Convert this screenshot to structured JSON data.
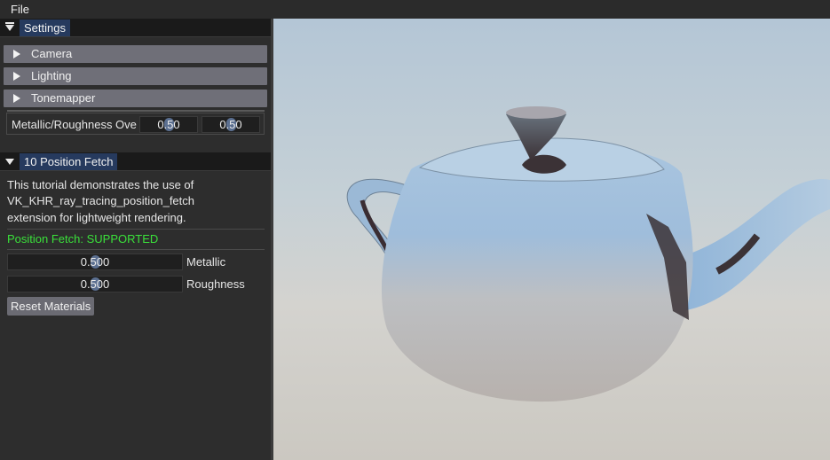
{
  "menubar": {
    "file": "File"
  },
  "settings": {
    "title": "Settings",
    "headers": [
      "Camera",
      "Lighting",
      "Tonemapper"
    ],
    "override_label": "Metallic/Roughness Ove",
    "override_metallic": "0.50",
    "override_roughness": "0.50"
  },
  "tutorial": {
    "title": "10 Position Fetch",
    "description_lines": [
      "This tutorial demonstrates the use of",
      "VK_KHR_ray_tracing_position_fetch",
      "extension for lightweight rendering."
    ],
    "status": "Position Fetch: SUPPORTED",
    "metallic": {
      "value": "0.500",
      "label": "Metallic",
      "fraction": 0.5
    },
    "roughness": {
      "value": "0.500",
      "label": "Roughness",
      "fraction": 0.5
    },
    "reset_label": "Reset Materials"
  },
  "colors": {
    "status_green": "#3ae03a",
    "tab_blue": "#263a5e",
    "header_gray": "#6f6f78"
  }
}
